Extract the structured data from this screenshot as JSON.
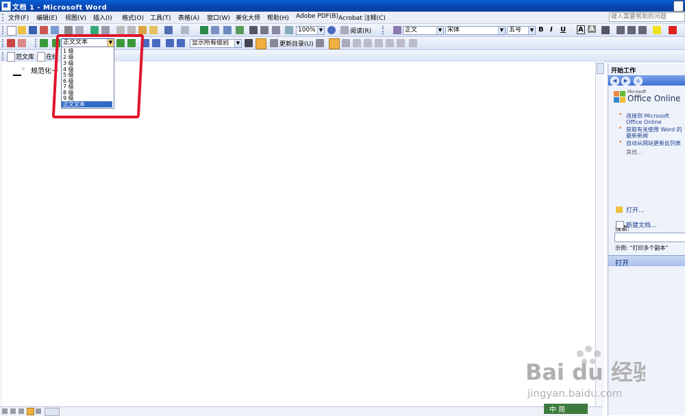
{
  "window": {
    "title": "文档 1 - Microsoft Word"
  },
  "menubar": {
    "items": [
      "文件(F)",
      "编辑(E)",
      "视图(V)",
      "插入(I)",
      "格式(O)",
      "工具(T)",
      "表格(A)",
      "窗口(W)",
      "美化大师",
      "帮助(H)",
      "Adobe PDF(B)",
      "Acrobat 注释(C)"
    ],
    "help_placeholder": "键入需要帮助的问题"
  },
  "toolbar_standard": {
    "zoom": "100%",
    "read_label": "阅读(R)",
    "style": "正文",
    "font": "宋体",
    "size": "五号",
    "bold": "B",
    "italic": "I",
    "underline": "U",
    "char_border": "A",
    "char_shade": "A"
  },
  "toolbar_outline": {
    "level_value": "正文文本",
    "show_level": "显示所有级别",
    "update_toc": "更新目录(U)"
  },
  "toolbar_extra": {
    "items": [
      "范文库",
      "在线"
    ]
  },
  "dropdown": {
    "options": [
      "1 级",
      "2 级",
      "3 级",
      "4 级",
      "5 级",
      "6 级",
      "7 级",
      "8 级",
      "9 级",
      "正文文本"
    ],
    "selected": "正文文本"
  },
  "document": {
    "text": "规范化一"
  },
  "taskpane": {
    "title": "开始工作",
    "office_brand_small": "Microsoft",
    "office_brand": "Office Online",
    "links": [
      "连接到 Microsoft Office Online",
      "获取有关使用 Word 的最新新闻",
      "自动从网站更新此列表"
    ],
    "more": "其他...",
    "search_label": "搜索:",
    "example": "示例: “打印多个副本”",
    "open_header": "打开",
    "open_link": "打开...",
    "new_doc": "新建文档..."
  },
  "watermark": {
    "brand": "Bai du 经验",
    "url": "jingyan.baidu.com",
    "ime": "中 简"
  },
  "colors": {
    "title_bar": "#0846b0",
    "selection": "#316ac5",
    "highlight_box": "#e0142b",
    "toolbar": "#d9e3f5"
  }
}
